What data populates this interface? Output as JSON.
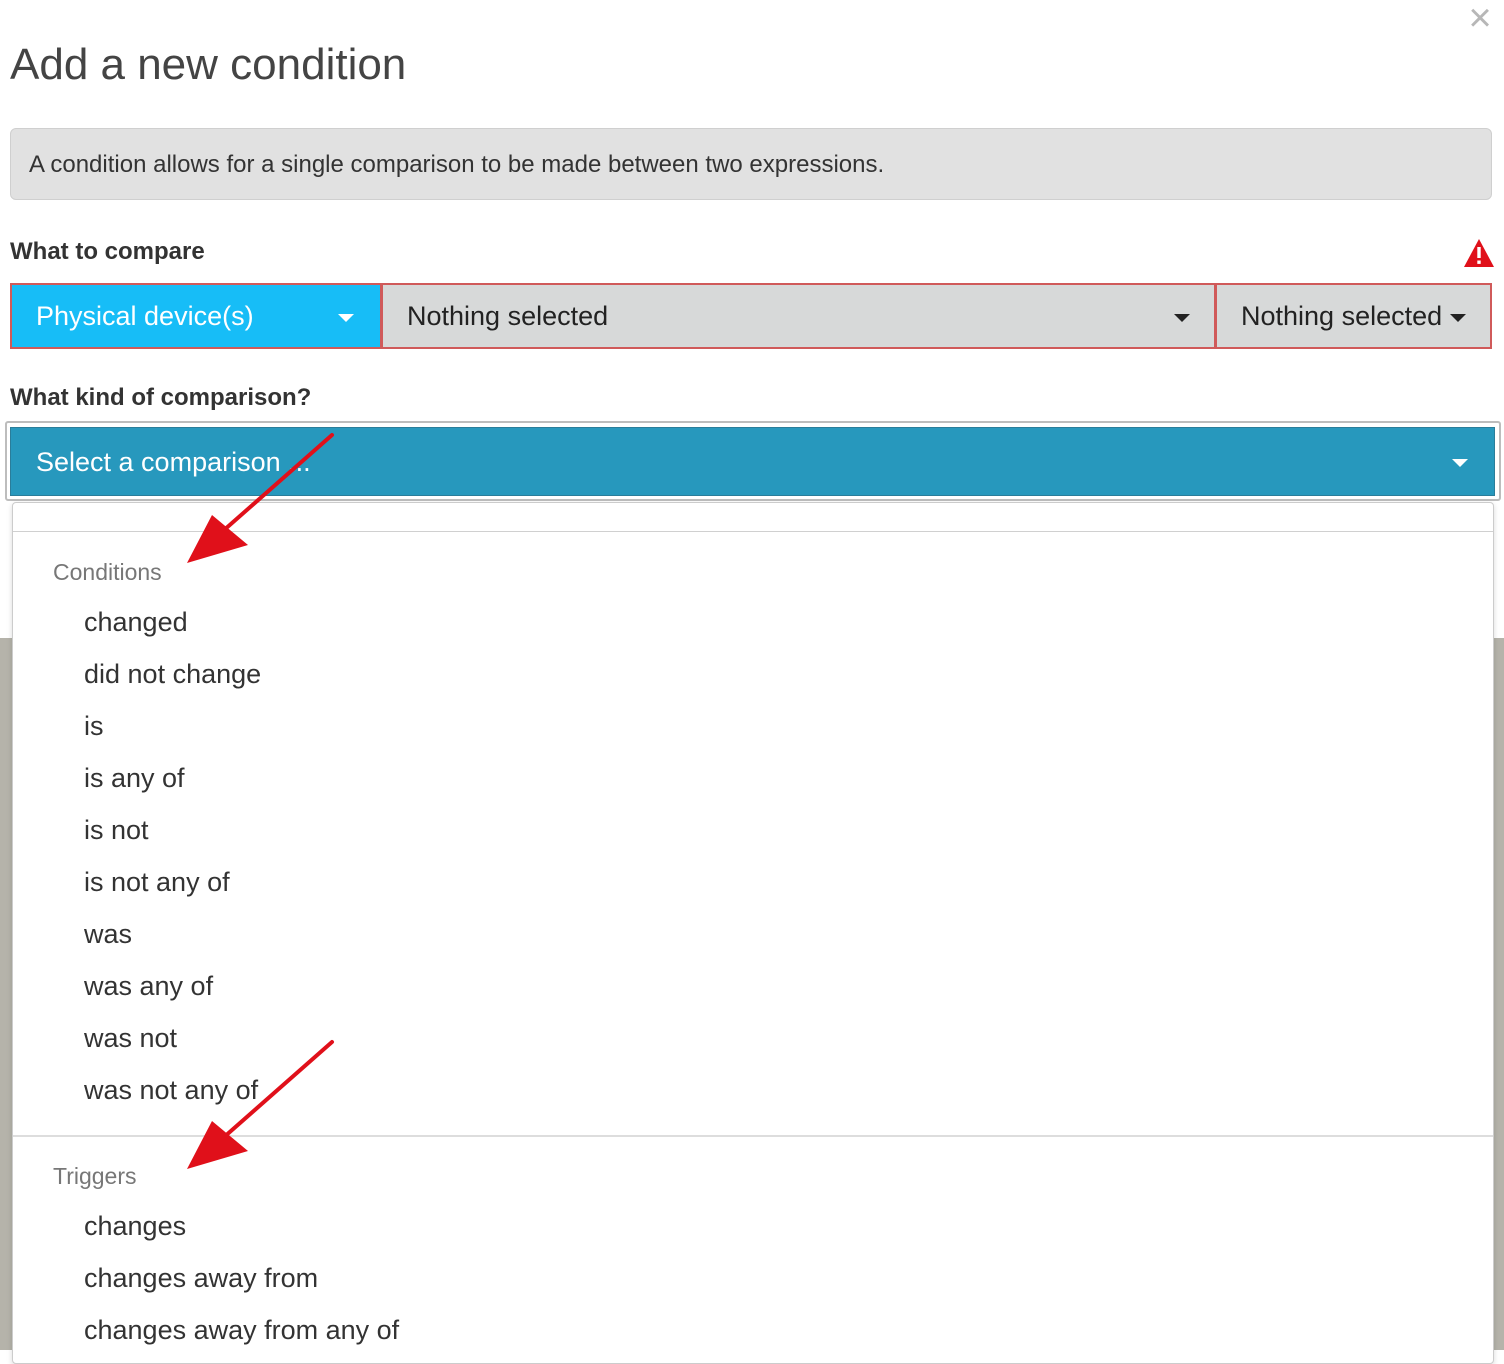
{
  "modal": {
    "title": "Add a new condition",
    "info": "A condition allows for a single comparison to be made between two expressions.",
    "close_glyph": "×"
  },
  "compare": {
    "label": "What to compare",
    "device_select": "Physical device(s)",
    "middle_select": "Nothing selected",
    "right_select": "Nothing selected"
  },
  "comparison": {
    "label": "What kind of comparison?",
    "placeholder": "Select a comparison ...",
    "groups": [
      {
        "label": "Conditions",
        "options": [
          "changed",
          "did not change",
          "is",
          "is any of",
          "is not",
          "is not any of",
          "was",
          "was any of",
          "was not",
          "was not any of"
        ]
      },
      {
        "label": "Triggers",
        "options": [
          "changes",
          "changes away from",
          "changes away from any of"
        ]
      }
    ]
  },
  "colors": {
    "device_select_bg": "#17bdf7",
    "comparison_select_bg": "#2798bd",
    "error_border": "#d05a5a",
    "warning_icon": "#e0101a",
    "annotation_arrow": "#e0101a"
  },
  "icons": {
    "warning": "warning-triangle-icon",
    "close": "close-icon",
    "caret": "caret-down-icon"
  }
}
